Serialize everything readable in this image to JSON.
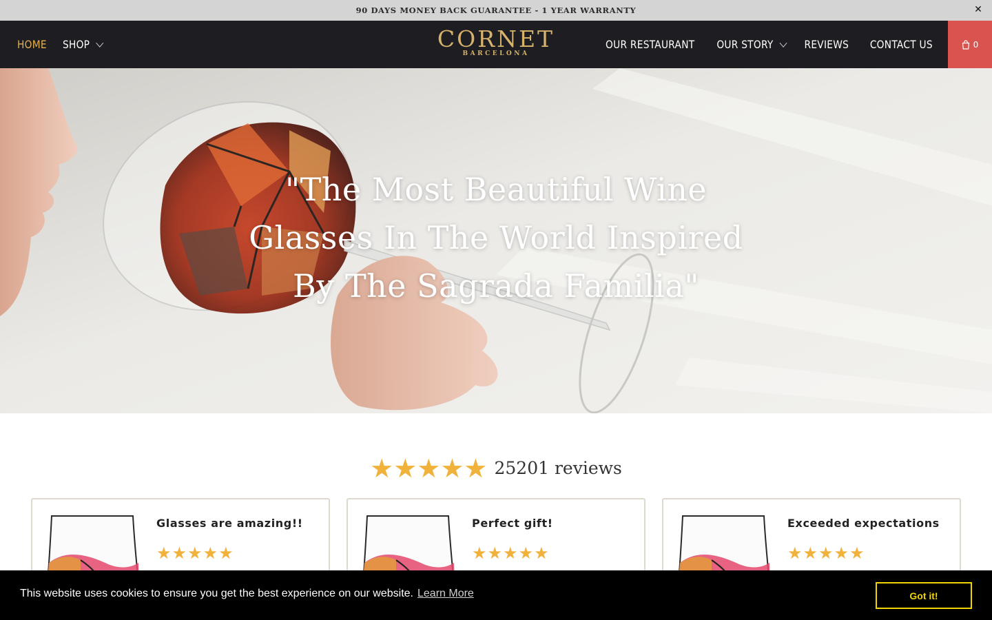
{
  "announcement": {
    "text": "90 DAYS MONEY BACK GUARANTEE - 1 YEAR WARRANTY",
    "close_icon": "close-icon",
    "close_label": "✕"
  },
  "header": {
    "left_nav": [
      {
        "label": "HOME",
        "active": true
      },
      {
        "label": "SHOP",
        "dropdown": true
      }
    ],
    "logo": {
      "main": "CORNET",
      "sub": "BARCELONA"
    },
    "right_nav": [
      {
        "label": "OUR RESTAURANT"
      },
      {
        "label": "OUR STORY",
        "dropdown": true
      },
      {
        "label": "REVIEWS"
      },
      {
        "label": "CONTACT US"
      }
    ],
    "cart": {
      "icon": "shopping-bag-icon",
      "count": "0"
    },
    "colors": {
      "bg": "#1e1e22",
      "active": "#e6b04f",
      "cart_bg": "#d9534f",
      "logo": "#d6b26a"
    }
  },
  "hero": {
    "title": "\"The Most Beautiful Wine Glasses In The World Inspired By The Sagrada Familia\""
  },
  "reviews": {
    "summary_stars": "★★★★★",
    "rating": 5,
    "count_text": "25201 reviews",
    "star_color": "#f0b23b",
    "cards": [
      {
        "title": "Glasses are amazing!!",
        "stars": "★★★★★",
        "rating": 5
      },
      {
        "title": "Perfect gift!",
        "stars": "★★★★★",
        "rating": 5
      },
      {
        "title": "Exceeded expectations",
        "stars": "★★★★★",
        "rating": 5
      }
    ]
  },
  "cookie": {
    "message": "This website uses cookies to ensure you get the best experience on our website.",
    "link": "Learn More",
    "button": "Got it!",
    "accent": "#f1d600"
  }
}
